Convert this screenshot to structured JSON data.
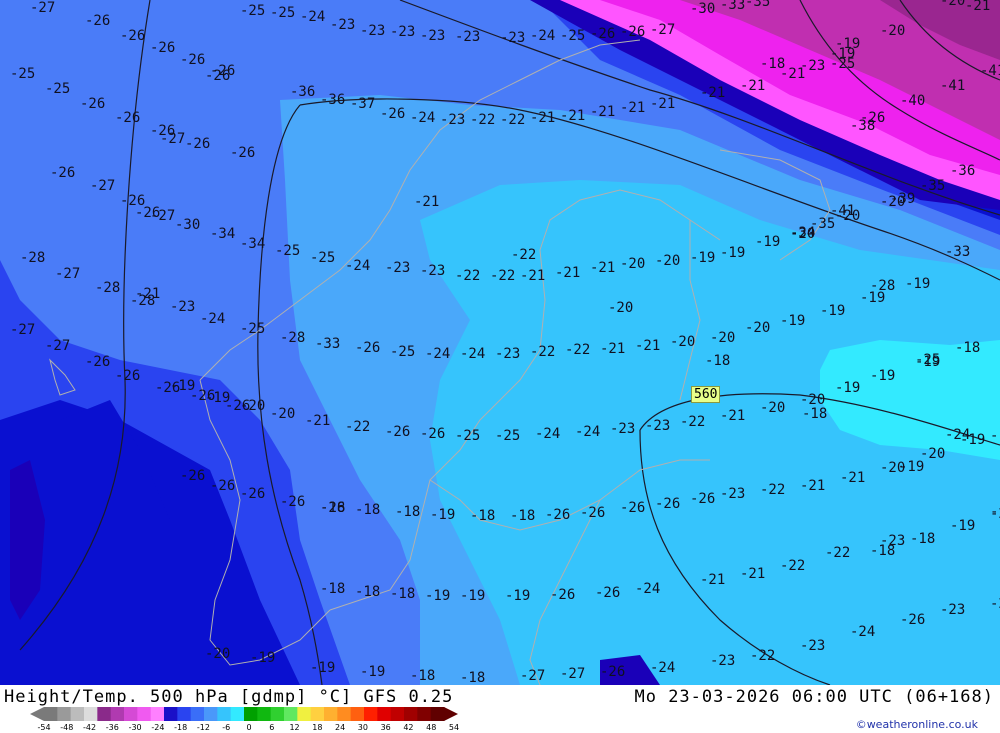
{
  "map": {
    "colors": {
      "band_m28": "#0a10d0",
      "band_m26": "#2a44f0",
      "band_m24": "#4a7cf8",
      "band_m22": "#4aa8fa",
      "band_m20": "#36c4fc",
      "band_m18": "#33eaff",
      "band_m30": "#1a00b8",
      "band_m34": "#ff55ff",
      "band_m36": "#ee22ee",
      "band_m38": "#c02fb0",
      "band_m40": "#9a2690",
      "coast": "#b0b0b0",
      "contour": "#1a1a2a"
    },
    "isoline_label": "560",
    "temperature_labels": [
      "-27",
      "-26",
      "-26",
      "-26",
      "-26",
      "-26",
      "-25",
      "-25",
      "-26",
      "-26",
      "-26",
      "-26",
      "-26",
      "-27",
      "-26",
      "-26",
      "-27",
      "-26",
      "-27",
      "-28",
      "-27",
      "-28",
      "-28",
      "-27",
      "-27",
      "-26",
      "-26",
      "-26",
      "-26",
      "-26",
      "-26",
      "-26",
      "-26",
      "-26",
      "-26",
      "-25",
      "-25",
      "-24",
      "-23",
      "-23",
      "-23",
      "-23",
      "-23",
      "-23",
      "-24",
      "-25",
      "-26",
      "-26",
      "-27",
      "-30",
      "-33",
      "-35",
      "-36",
      "-36",
      "-37",
      "-26",
      "-24",
      "-23",
      "-22",
      "-22",
      "-21",
      "-21",
      "-21",
      "-21",
      "-21",
      "-21",
      "-21",
      "-21",
      "-23",
      "-25",
      "-26",
      "-26",
      "-30",
      "-34",
      "-34",
      "-25",
      "-25",
      "-24",
      "-23",
      "-23",
      "-22",
      "-22",
      "-21",
      "-21",
      "-21",
      "-20",
      "-20",
      "-19",
      "-19",
      "-19",
      "-20",
      "-20",
      "-20",
      "-21",
      "-23",
      "-24",
      "-25",
      "-28",
      "-33",
      "-26",
      "-25",
      "-24",
      "-24",
      "-23",
      "-22",
      "-22",
      "-21",
      "-21",
      "-20",
      "-20",
      "-20",
      "-19",
      "-19",
      "-19",
      "-19",
      "-19",
      "-19",
      "-20",
      "-20",
      "-21",
      "-22",
      "-26",
      "-26",
      "-25",
      "-25",
      "-24",
      "-24",
      "-23",
      "-23",
      "-22",
      "-21",
      "-20",
      "-20",
      "-19",
      "-19",
      "-19",
      "-18",
      "-18",
      "-18",
      "-18",
      "-19",
      "-18",
      "-18",
      "-26",
      "-26",
      "-26",
      "-26",
      "-26",
      "-23",
      "-22",
      "-21",
      "-21",
      "-20",
      "-20",
      "-19",
      "-19",
      "-19",
      "-19",
      "-18",
      "-18",
      "-18",
      "-18",
      "-18",
      "-19",
      "-19",
      "-19",
      "-26",
      "-26",
      "-24",
      "-21",
      "-21",
      "-22",
      "-22",
      "-23",
      "-21",
      "-20",
      "-19",
      "-19",
      "-19",
      "-18",
      "-18",
      "-27",
      "-27",
      "-26",
      "-24",
      "-23",
      "-22",
      "-23",
      "-24",
      "-26",
      "-23",
      "-20",
      "-21",
      "-20",
      "-19",
      "-19",
      "-18",
      "-41",
      "-41",
      "-40",
      "-38",
      "-36",
      "-35",
      "-39",
      "-41",
      "-35",
      "-34",
      "-33",
      "-28",
      "-25",
      "-24",
      "-23",
      "-21",
      "-22",
      "-20",
      "-18",
      "-18",
      "-19"
    ]
  },
  "footer": {
    "title": "Height/Temp. 500 hPa [gdmp] °C] GFS 0.25",
    "datetime": "Mo 23-03-2026 06:00 UTC (06+168)",
    "credit": "©weatheronline.co.uk",
    "colorbar_ticks": [
      "-54",
      "-48",
      "-42",
      "-36",
      "-30",
      "-24",
      "-18",
      "-12",
      "-6",
      "0",
      "6",
      "12",
      "18",
      "24",
      "30",
      "36",
      "42",
      "48",
      "54"
    ],
    "colorbar_colors": [
      "#7a7a7a",
      "#9a9a9a",
      "#bcbcbc",
      "#dcdcdc",
      "#8a2a8a",
      "#b03ab0",
      "#d54ad5",
      "#f05af0",
      "#ff80ff",
      "#1a10c8",
      "#2a44f0",
      "#3a6ef8",
      "#4a98fa",
      "#36c4fc",
      "#33eaff",
      "#00a000",
      "#10b810",
      "#30d030",
      "#60e860",
      "#f0f040",
      "#ffd040",
      "#ffb030",
      "#ff8c20",
      "#ff6010",
      "#ff2000",
      "#e00000",
      "#c00000",
      "#a00000",
      "#800000",
      "#600000"
    ]
  }
}
